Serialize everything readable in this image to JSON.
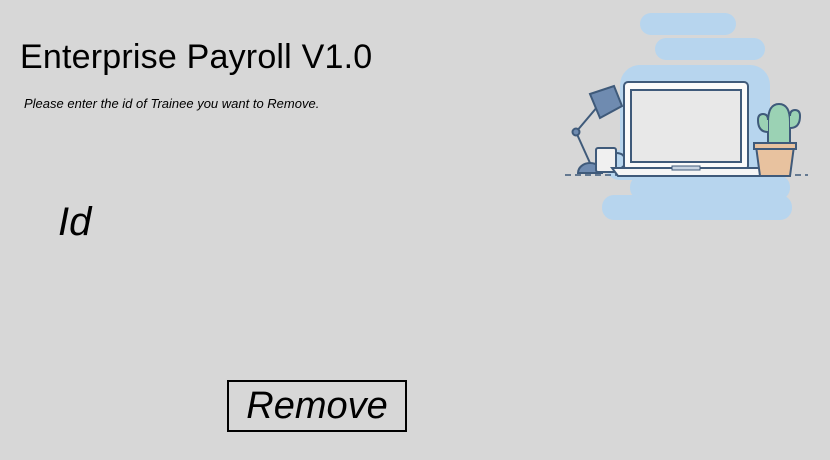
{
  "header": {
    "title": "Enterprise Payroll V1.0",
    "instruction": "Please enter the id of Trainee you want to Remove."
  },
  "form": {
    "id_label": "Id",
    "remove_button_label": "Remove"
  },
  "illustration": {
    "name": "desk-workspace-illustration",
    "colors": {
      "background_blob": "#b7d5ee",
      "outline": "#3f5a7a",
      "screen": "#f0f0f0",
      "lamp": "#6f8bb0",
      "cactus": "#9bd2b4",
      "pot": "#e8c29f"
    }
  }
}
